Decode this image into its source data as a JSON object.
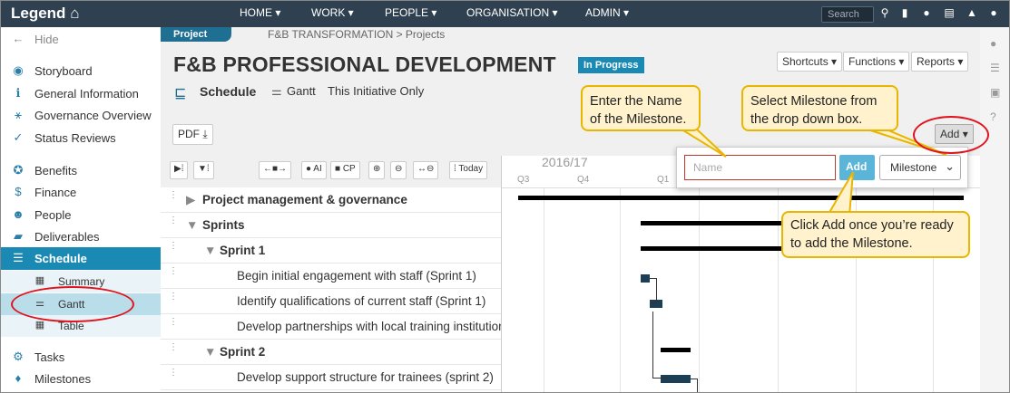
{
  "topbar": {
    "logo": "Legend",
    "nav": [
      "HOME",
      "WORK",
      "PEOPLE",
      "ORGANISATION",
      "ADMIN"
    ],
    "search_placeholder": "Search"
  },
  "sidebar": {
    "hide": "Hide",
    "items": [
      "Storyboard",
      "General Information",
      "Governance Overview",
      "Status Reviews",
      "Benefits",
      "Finance",
      "People",
      "Deliverables",
      "Schedule"
    ],
    "sub_items": [
      "Summary",
      "Gantt",
      "Table"
    ],
    "bottom_items": [
      "Tasks",
      "Milestones"
    ]
  },
  "header": {
    "tag": "Project",
    "breadcrumb": "F&B TRANSFORMATION > Projects",
    "title": "F&B PROFESSIONAL DEVELOPMENT",
    "status": "In Progress",
    "buttons": [
      "Shortcuts",
      "Functions",
      "Reports"
    ],
    "view_label": "Schedule",
    "view_gantt": "Gantt",
    "view_filter": "This Initiative Only",
    "pdf": "PDF",
    "add": "Add"
  },
  "toolbar": {
    "ai": "AI",
    "cp": "CP",
    "today": "Today"
  },
  "timeline": {
    "year": "2016/17",
    "quarters": [
      "Q3",
      "Q4",
      "Q1"
    ]
  },
  "rows": [
    {
      "label": "Project management & governance",
      "level": 0
    },
    {
      "label": "Sprints",
      "level": 0
    },
    {
      "label": "Sprint 1",
      "level": 1
    },
    {
      "label": "Begin initial engagement with staff (Sprint 1)",
      "level": 2
    },
    {
      "label": "Identify qualifications of current staff (Sprint 1)",
      "level": 2
    },
    {
      "label": "Develop partnerships with local training institutions",
      "level": 2
    },
    {
      "label": "Sprint 2",
      "level": 1
    },
    {
      "label": "Develop support structure for trainees (sprint 2)",
      "level": 2
    }
  ],
  "popup": {
    "name_placeholder": "Name",
    "add_button": "Add",
    "type_selected": "Milestone"
  },
  "callouts": {
    "name": "Enter the Name of the Milestone.",
    "select": "Select Milestone from the drop down box.",
    "add": "Click Add once you’re ready to add the Milestone."
  },
  "colors": {
    "topbar": "#2f4150",
    "accent": "#1a8ab5",
    "callout_bg": "#fff2cc",
    "callout_border": "#e8b500",
    "highlight_ring": "#e0141e"
  }
}
